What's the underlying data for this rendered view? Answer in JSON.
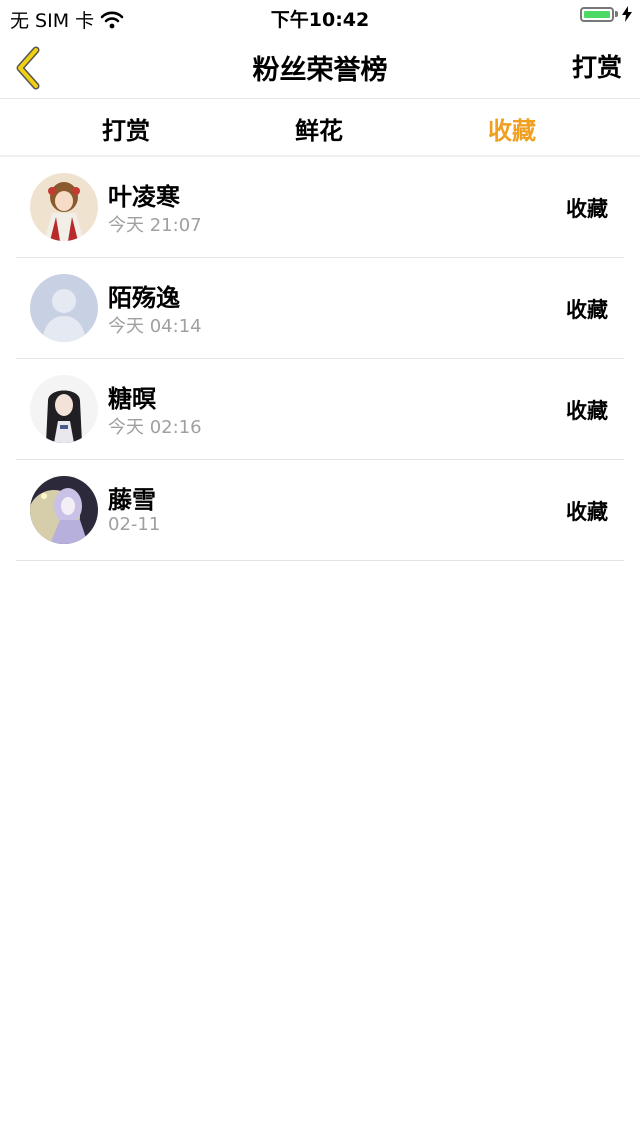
{
  "status_bar": {
    "carrier": "无 SIM 卡",
    "time": "下午10:42",
    "battery_level": 1.0,
    "battery_color": "#4cd964"
  },
  "nav": {
    "back_icon": "chevron-left-icon",
    "back_icon_color": "#f0d010",
    "title": "粉丝荣誉榜",
    "right_button": "打赏"
  },
  "tabs": [
    {
      "label": "打赏",
      "active": false
    },
    {
      "label": "鲜花",
      "active": false
    },
    {
      "label": "收藏",
      "active": true
    }
  ],
  "accent_color": "#f0a020",
  "list": [
    {
      "name": "叶凌寒",
      "time": "今天 21:07",
      "action": "收藏",
      "avatar": "anime-girl-red-dress-avatar"
    },
    {
      "name": "陌殇逸",
      "time": "今天 04:14",
      "action": "收藏",
      "avatar": "default-user-silhouette-avatar"
    },
    {
      "name": "糖暝",
      "time": "今天 02:16",
      "action": "收藏",
      "avatar": "anime-girl-dark-hair-avatar"
    },
    {
      "name": "藤雪",
      "time": "02-11",
      "action": "收藏",
      "avatar": "anime-girl-lavender-avatar"
    }
  ]
}
